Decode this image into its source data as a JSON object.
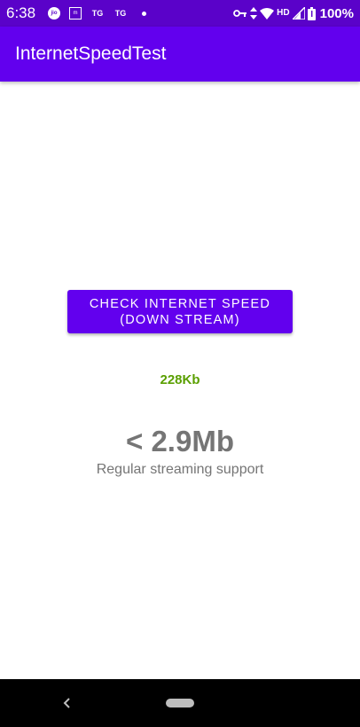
{
  "status_bar": {
    "time": "6:38",
    "left_icons": [
      "jio-icon",
      "media-icon",
      "tg-icon",
      "tg-icon",
      "dot-icon"
    ],
    "tg_label_1": "TG",
    "tg_label_2": "TG",
    "jio_label": "jio",
    "media_label": "m",
    "network_label": "HD",
    "battery_percent": "100%",
    "colors": {
      "background": "#5a02c9",
      "foreground": "#ffffff"
    }
  },
  "app_bar": {
    "title": "InternetSpeedTest",
    "color": "#6200ee"
  },
  "main": {
    "check_button_label": "CHECK INTERNET SPEED\n(DOWN STREAM)",
    "measured_speed": "228Kb",
    "speed_category": "< 2.9Mb",
    "speed_description": "Regular streaming support",
    "colors": {
      "measured_speed": "#5a9f00",
      "category_text": "#757575"
    }
  },
  "nav_bar": {
    "icons": [
      "back-icon",
      "home-pill-icon"
    ]
  }
}
